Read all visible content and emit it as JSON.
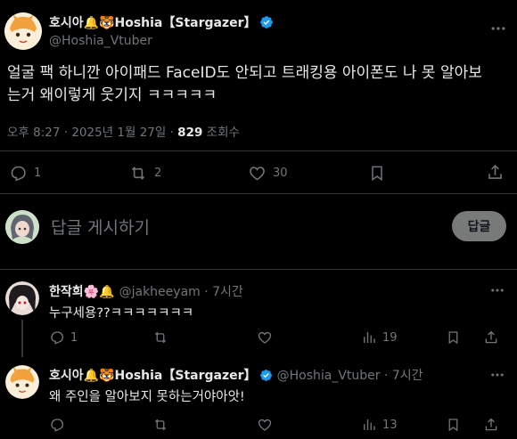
{
  "main_post": {
    "display_name": "호시아🔔🐯Hoshia【Stargazer】",
    "handle": "@Hoshia_Vtuber",
    "text_line1": "얼굴 팩 하니깐 아이패드 FaceID도 안되고 트래킹용 아이폰도 나 못 알아보",
    "text_line2": "는거 왜이렇게 웃기지 ㅋㅋㅋㅋㅋ",
    "timestamp": "오후 8:27 · 2025년 1월 27일 · ",
    "views_count": "829",
    "views_label": " 조회수",
    "actions": {
      "replies": "1",
      "retweets": "2",
      "likes": "30"
    }
  },
  "reply_box": {
    "placeholder": "답글 게시하기",
    "button_label": "답글"
  },
  "replies": [
    {
      "display_name": "한작희🌸🔔",
      "handle": "@jakheeyam · 7시간",
      "text": "누구세용??ㅋㅋㅋㅋㅋㅋㅋ",
      "actions": {
        "replies": "1",
        "retweets": "",
        "likes": "",
        "views": "19"
      }
    },
    {
      "display_name": "호시아🔔🐯Hoshia【Stargazer】",
      "handle": "@Hoshia_Vtuber · 7시간",
      "text": "왜 주인을 알아보지 못하는거야아앗!",
      "actions": {
        "replies": "",
        "retweets": "",
        "likes": "",
        "views": "13"
      }
    }
  ],
  "colors": {
    "background": "#000000",
    "text": "#e7e9ea",
    "muted": "#71767b",
    "verified": "#1d9bf0",
    "divider": "#2f3336"
  }
}
